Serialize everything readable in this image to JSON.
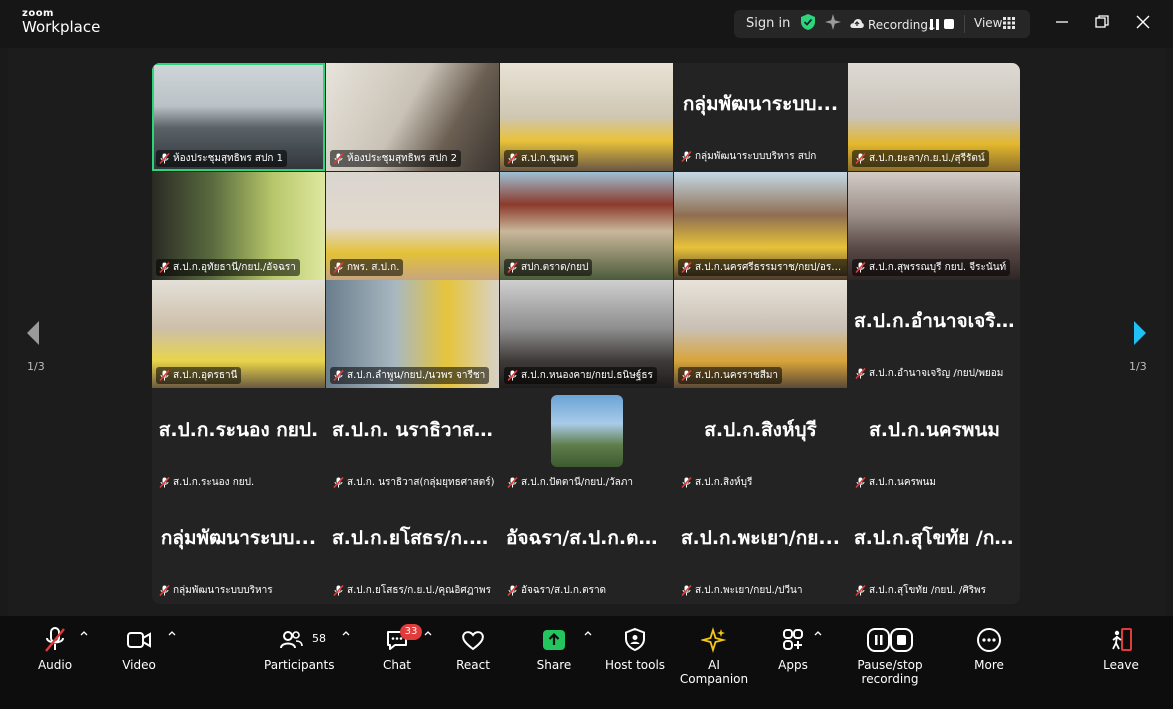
{
  "app": {
    "brand_top": "zoom",
    "brand_bottom": "Workplace"
  },
  "topbar": {
    "signin": "Sign in",
    "recording": "Recording...",
    "view": "View"
  },
  "page_indicator": {
    "left": "1/3",
    "right": "1/3"
  },
  "tiles": [
    {
      "name": "ห้องประชุมสุทธิพร สปก 1",
      "video": true,
      "scene": "room1",
      "active": true
    },
    {
      "name": "ห้องประชุมสุทธิพร สปก 2",
      "video": true,
      "scene": "room2"
    },
    {
      "name": "ส.ป.ก.ชุมพร",
      "video": true,
      "scene": "office1"
    },
    {
      "name": "กลุ่มพัฒนาระบบบริหาร สปก",
      "video": false,
      "display": "กลุ่มพัฒนาระบบ..."
    },
    {
      "name": "ส.ป.ก.ยะลา/ก.ย.ป./สุรีรัตน์",
      "video": true,
      "scene": "person1"
    },
    {
      "name": "ส.ป.ก.อุทัยธานี/กยป./อัจฉรา",
      "video": true,
      "scene": "person2"
    },
    {
      "name": "กพร. ส.ป.ก.",
      "video": true,
      "scene": "person3"
    },
    {
      "name": "สปก.ตราด/กยป",
      "video": true,
      "scene": "building"
    },
    {
      "name": "ส.ป.ก.นครศรีธรรมราช/กยป/อรนิ...",
      "video": true,
      "scene": "temple"
    },
    {
      "name": "ส.ป.ก.สุพรรณบุรี กยป. จีระนันท์",
      "video": true,
      "scene": "person4"
    },
    {
      "name": "ส.ป.ก.อุดรธานี",
      "video": true,
      "scene": "man"
    },
    {
      "name": "ส.ป.ก.ลำพูน/กยป./นวพร จารีชา",
      "video": true,
      "scene": "shelf"
    },
    {
      "name": "ส.ป.ก.หนองคาย/กยป.ธนิษฐ์ธร",
      "video": true,
      "scene": "person5"
    },
    {
      "name": "ส.ป.ก.นครราชสีมา",
      "video": true,
      "scene": "person6"
    },
    {
      "name": "ส.ป.ก.อำนาจเจริญ /กยป/พยอม",
      "video": false,
      "display": "ส.ป.ก.อำนาจเจริ..."
    },
    {
      "name": "ส.ป.ก.ระนอง กยป.",
      "video": false,
      "display": "ส.ป.ก.ระนอง กยป."
    },
    {
      "name": "ส.ป.ก. นราธิวาส(กลุ่มยุทธศาสตร์)",
      "video": false,
      "display": "ส.ป.ก. นราธิวาส(..."
    },
    {
      "name": "ส.ป.ก.ปัตตานี/กยป./วัลภา",
      "video": false,
      "avatar": true
    },
    {
      "name": "ส.ป.ก.สิงห์บุรี",
      "video": false,
      "display": "ส.ป.ก.สิงห์บุรี"
    },
    {
      "name": "ส.ป.ก.นครพนม",
      "video": false,
      "display": "ส.ป.ก.นครพนม"
    },
    {
      "name": "กลุ่มพัฒนาระบบบริหาร",
      "video": false,
      "display": "กลุ่มพัฒนาระบบ..."
    },
    {
      "name": "ส.ป.ก.ยโสธร/ก.ย.ป./คุณอิศฎาพร",
      "video": false,
      "display": "ส.ป.ก.ยโสธร/ก.ย..."
    },
    {
      "name": "อัจฉรา/ส.ป.ก.ตราด",
      "video": false,
      "display": "อัจฉรา/ส.ป.ก.ตราด"
    },
    {
      "name": "ส.ป.ก.พะเยา/กยป./ปวีนา",
      "video": false,
      "display": "ส.ป.ก.พะเยา/กย..."
    },
    {
      "name": "ส.ป.ก.สุโขทัย /กยป. /ศิริพร",
      "video": false,
      "display": "ส.ป.ก.สุโขทัย /ก..."
    }
  ],
  "toolbar": {
    "audio": "Audio",
    "video": "Video",
    "participants": "Participants",
    "participants_count": "58",
    "chat": "Chat",
    "chat_badge": "33",
    "react": "React",
    "share": "Share",
    "host_tools": "Host tools",
    "ai_companion": "AI Companion",
    "apps": "Apps",
    "pause_recording": "Pause/stop recording",
    "more": "More",
    "leave": "Leave"
  },
  "colors": {
    "active_border": "#2ed47a",
    "share_green": "#23c55e",
    "leave_red": "#e03c3c",
    "nav_arrow_blue": "#1ec0f5",
    "shield_green": "#2ed47a"
  }
}
